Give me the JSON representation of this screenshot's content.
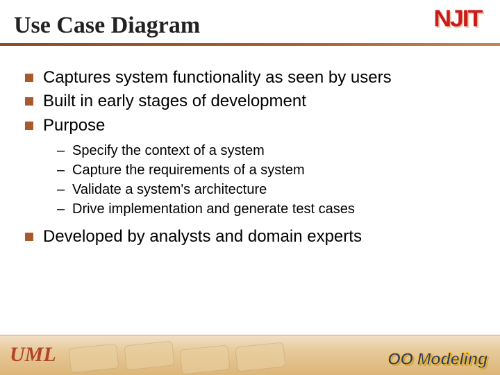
{
  "header": {
    "title": "Use Case Diagram",
    "logo": "NJIT"
  },
  "bullets": {
    "b1": "Captures system functionality as seen by users",
    "b2": "Built in early stages of development",
    "b3": "Purpose",
    "b3_sub": {
      "s1": "Specify the context of a system",
      "s2": "Capture the requirements of a system",
      "s3": "Validate a system's architecture",
      "s4": "Drive implementation and generate test cases"
    },
    "b4": "Developed by analysts and domain experts"
  },
  "footer": {
    "left_label": "UML",
    "right_label": "OO Modeling"
  }
}
